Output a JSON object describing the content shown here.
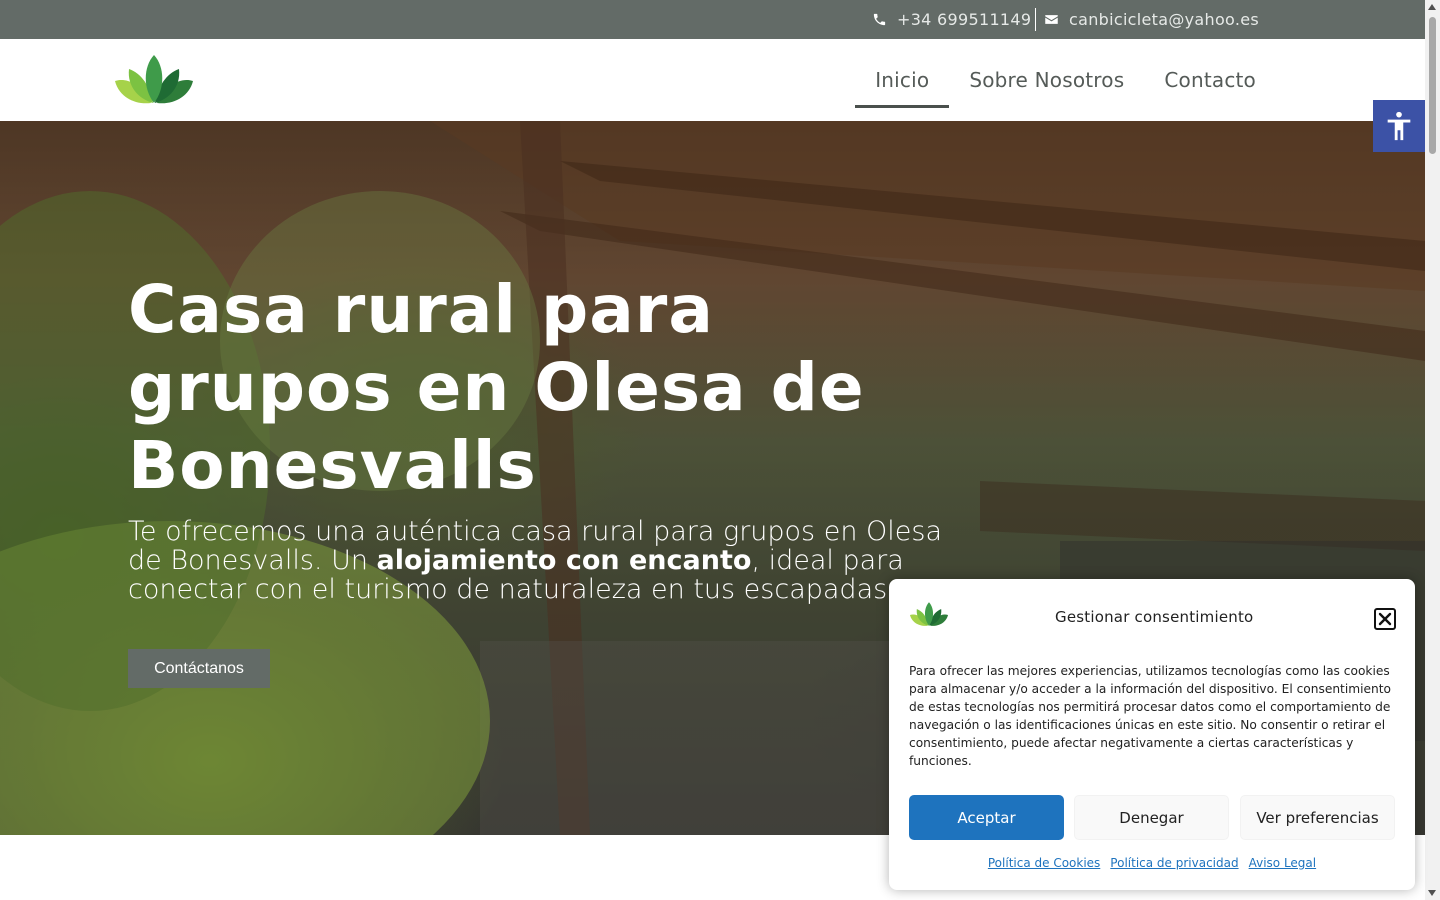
{
  "topbar": {
    "phone": "+34 699511149",
    "email": "canbicicleta@yahoo.es",
    "phone_icon": "phone-icon",
    "email_icon": "envelope-icon"
  },
  "header": {
    "logo_icon": "lotus-logo-icon",
    "nav": [
      {
        "label": "Inicio",
        "active": true
      },
      {
        "label": "Sobre Nosotros",
        "active": false
      },
      {
        "label": "Contacto",
        "active": false
      }
    ]
  },
  "hero": {
    "title": "Casa rural para grupos en Olesa de Bonesvalls",
    "subtitle_before": "Te ofrecemos una auténtica casa rural para grupos en Olesa de Bonesvalls. Un ",
    "subtitle_bold": "alojamiento con encanto",
    "subtitle_after": ", ideal para conectar con el turismo de naturaleza en tus escapadas.",
    "button_label": "Contáctanos"
  },
  "accessibility": {
    "icon": "accessibility-icon"
  },
  "consent": {
    "title": "Gestionar consentimiento",
    "text": "Para ofrecer las mejores experiencias, utilizamos tecnologías como las cookies para almacenar y/o acceder a la información del dispositivo. El consentimiento de estas tecnologías nos permitirá procesar datos como el comportamiento de navegación o las identificaciones únicas en este sitio. No consentir o retirar el consentimiento, puede afectar negativamente a ciertas características y funciones.",
    "accept_label": "Aceptar",
    "deny_label": "Denegar",
    "prefs_label": "Ver preferencias",
    "links": [
      "Política de Cookies",
      "Política de privacidad",
      "Aviso Legal"
    ]
  },
  "colors": {
    "topbar_bg": "#636b67",
    "accent_blue": "#1e73be",
    "a11y_blue": "#3c52a6",
    "nav_text": "#555b58"
  }
}
